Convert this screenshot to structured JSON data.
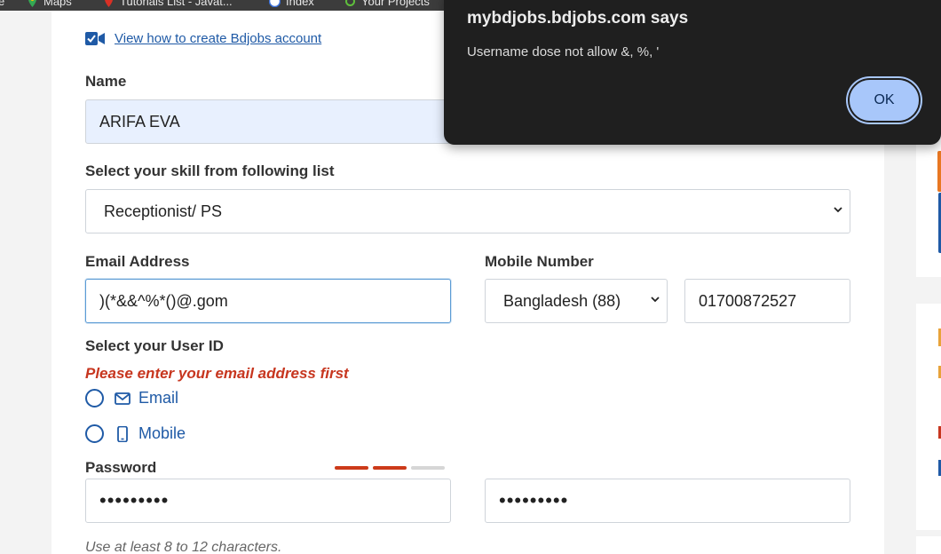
{
  "bookmarks": [
    {
      "label": "e",
      "icon": "none"
    },
    {
      "label": "Maps",
      "icon": "maps-pin-icon"
    },
    {
      "label": "Tutorials List - Javat...",
      "icon": "red-pin-icon"
    },
    {
      "label": "Index",
      "icon": "shield-icon"
    },
    {
      "label": "Your Projects",
      "icon": "green-circle-icon"
    }
  ],
  "form": {
    "video_link": "View how to create Bdjobs account",
    "name_label": "Name",
    "name_value": "ARIFA EVA",
    "skill_label": "Select your skill from following list",
    "skill_value": "Receptionist/ PS",
    "email_label": "Email Address",
    "email_value": ")(*&&^%*()@.gom",
    "mobile_label": "Mobile Number",
    "country_value": "Bangladesh (88)",
    "mobile_value": "01700872527",
    "userid_label": "Select your User ID",
    "userid_error": "Please enter your email address first",
    "userid_options": [
      "Email",
      "Mobile"
    ],
    "password_label": "Password",
    "password_value": "•••••••••",
    "confirm_password_value": "•••••••••",
    "password_hint": "Use at least 8 to 12 characters.",
    "strength_colors": [
      "#cc3a1a",
      "#cc3a1a",
      "#d6d6d6"
    ]
  },
  "dialog": {
    "title": "mybdjobs.bdjobs.com says",
    "message": "Username dose not allow &, %, '",
    "ok_label": "OK"
  },
  "colors": {
    "link": "#1f5aa6",
    "error": "#c7361f",
    "dialog_bg": "#1f1f1f",
    "ok_bg": "#a8c7fa"
  }
}
